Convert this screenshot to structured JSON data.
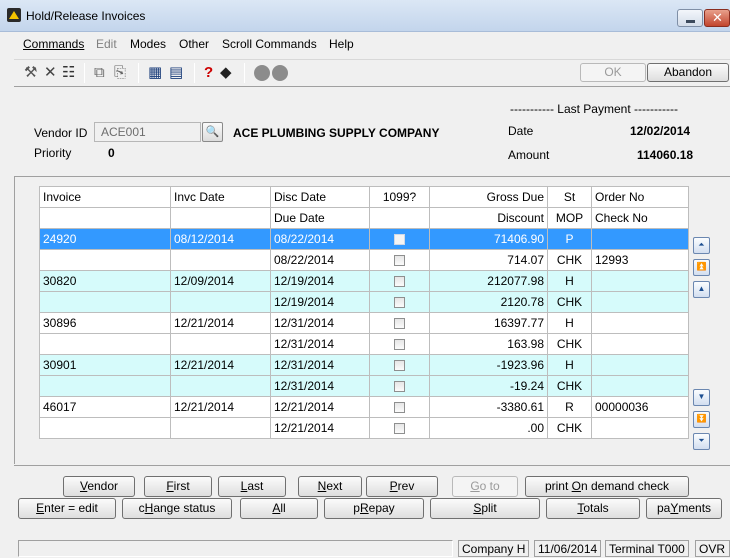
{
  "window": {
    "title": "Hold/Release Invoices"
  },
  "menu": [
    {
      "label": "Commands",
      "disabled": false
    },
    {
      "label": "Edit",
      "disabled": true
    },
    {
      "label": "Modes",
      "disabled": false
    },
    {
      "label": "Other",
      "disabled": false
    },
    {
      "label": "Scroll Commands",
      "disabled": false
    },
    {
      "label": "Help",
      "disabled": false
    }
  ],
  "toolbar": {
    "ok_label": "OK",
    "abandon_label": "Abandon",
    "ok_disabled": true
  },
  "vendor": {
    "id_label": "Vendor ID",
    "id_value": "ACE001",
    "name": "ACE PLUMBING SUPPLY COMPANY",
    "priority_label": "Priority",
    "priority_value": "0"
  },
  "last_payment": {
    "heading": "----------- Last Payment -----------",
    "date_label": "Date",
    "date_value": "12/02/2014",
    "amount_label": "Amount",
    "amount_value": "114060.18"
  },
  "grid": {
    "headers1": [
      "Invoice",
      "Invc Date",
      "Disc Date",
      "1099?",
      "Gross Due",
      "St",
      "Order No"
    ],
    "headers2": [
      "",
      "",
      "Due Date",
      "",
      "Discount",
      "MOP",
      "Check No"
    ],
    "rows": [
      {
        "style": "sel",
        "cells": [
          "24920",
          "08/12/2014",
          "08/22/2014",
          "",
          "71406.90",
          "P",
          ""
        ]
      },
      {
        "style": "white",
        "cells": [
          "",
          "",
          "08/22/2014",
          "",
          "714.07",
          "CHK",
          "12993"
        ]
      },
      {
        "style": "cyan",
        "cells": [
          "30820",
          "12/09/2014",
          "12/19/2014",
          "",
          "212077.98",
          "H",
          ""
        ]
      },
      {
        "style": "cyan",
        "cells": [
          "",
          "",
          "12/19/2014",
          "",
          "2120.78",
          "CHK",
          ""
        ]
      },
      {
        "style": "white",
        "cells": [
          "30896",
          "12/21/2014",
          "12/31/2014",
          "",
          "16397.77",
          "H",
          ""
        ]
      },
      {
        "style": "white",
        "cells": [
          "",
          "",
          "12/31/2014",
          "",
          "163.98",
          "CHK",
          ""
        ]
      },
      {
        "style": "cyan",
        "cells": [
          "30901",
          "12/21/2014",
          "12/31/2014",
          "",
          "-1923.96",
          "H",
          ""
        ]
      },
      {
        "style": "cyan",
        "cells": [
          "",
          "",
          "12/31/2014",
          "",
          "-19.24",
          "CHK",
          ""
        ]
      },
      {
        "style": "white",
        "cells": [
          "46017",
          "12/21/2014",
          "12/21/2014",
          "",
          "-3380.61",
          "R",
          "00000036"
        ]
      },
      {
        "style": "white",
        "cells": [
          "",
          "",
          "12/21/2014",
          "",
          ".00",
          "CHK",
          ""
        ]
      }
    ]
  },
  "buttons_row1": [
    {
      "pre": "",
      "key": "V",
      "post": "endor"
    },
    {
      "pre": "",
      "key": "F",
      "post": "irst"
    },
    {
      "pre": "",
      "key": "L",
      "post": "ast"
    },
    {
      "pre": "",
      "key": "N",
      "post": "ext"
    },
    {
      "pre": "",
      "key": "P",
      "post": "rev"
    },
    {
      "pre": "",
      "key": "G",
      "post": "o to"
    },
    {
      "pre": "print ",
      "key": "O",
      "post": "n demand check"
    }
  ],
  "buttons_row2": [
    {
      "pre": "",
      "key": "E",
      "post": "nter = edit"
    },
    {
      "pre": "c",
      "key": "H",
      "post": "ange status"
    },
    {
      "pre": "",
      "key": "A",
      "post": "ll"
    },
    {
      "pre": "p",
      "key": "R",
      "post": "epay"
    },
    {
      "pre": "",
      "key": "S",
      "post": "plit"
    },
    {
      "pre": "",
      "key": "T",
      "post": "otals"
    },
    {
      "pre": "pa",
      "key": "Y",
      "post": "ments"
    }
  ],
  "status": {
    "company": "Company H",
    "date": "11/06/2014",
    "terminal": "Terminal T000",
    "mode": "OVR"
  }
}
